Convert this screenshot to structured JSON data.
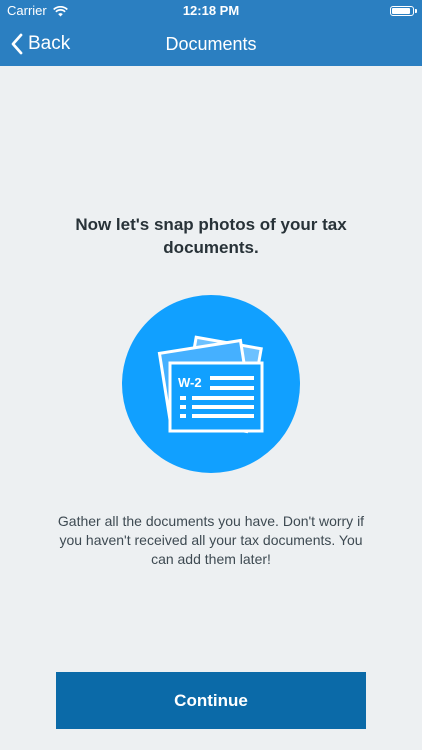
{
  "status_bar": {
    "carrier": "Carrier",
    "time": "12:18 PM",
    "wifi_icon": "wifi-icon",
    "battery_icon": "battery-icon"
  },
  "nav": {
    "back_label": "Back",
    "title": "Documents",
    "back_icon": "chevron-left-icon"
  },
  "main": {
    "headline": "Now let's snap photos of your tax documents.",
    "illustration_icon": "tax-documents-icon",
    "illustration_label": "W-2",
    "body": "Gather all the documents you have. Don't worry if you haven't received all your tax documents. You can add them later!"
  },
  "footer": {
    "continue_label": "Continue"
  },
  "colors": {
    "nav_background": "#2b7fc1",
    "page_background": "#edf0f2",
    "illustration_circle": "#11a0ff",
    "button_background": "#0b6aa8"
  }
}
